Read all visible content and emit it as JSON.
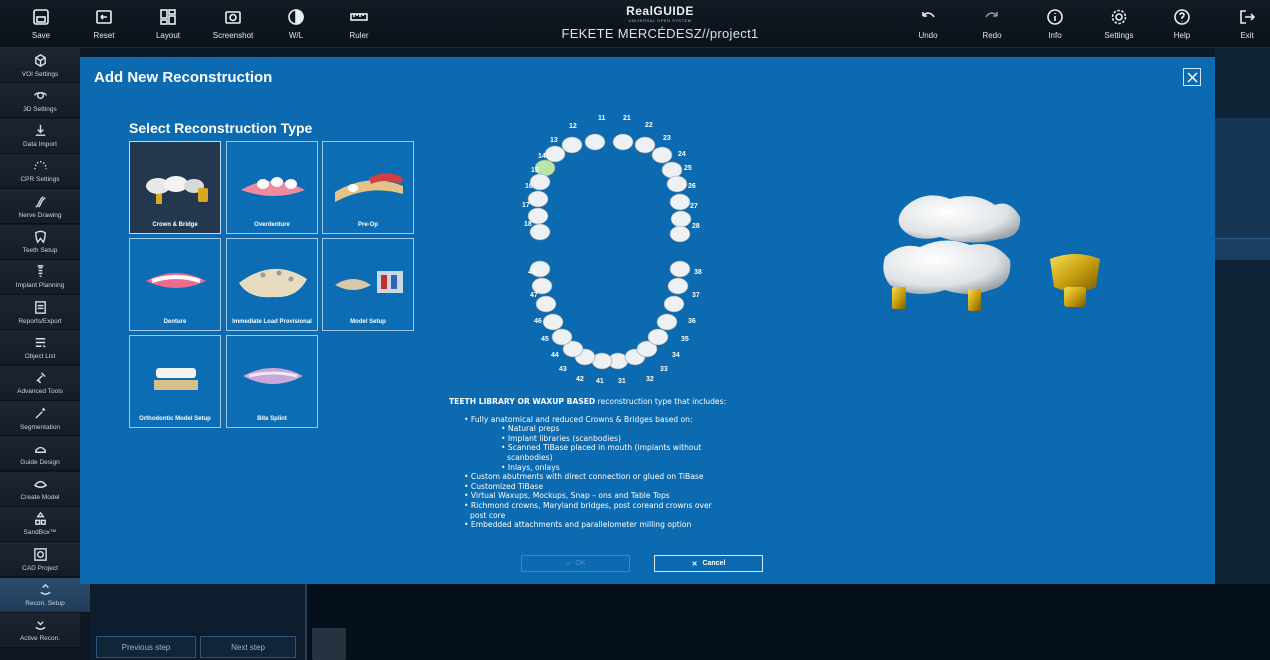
{
  "toolbar": {
    "save": "Save",
    "reset": "Reset",
    "layout": "Layout",
    "screenshot": "Screenshot",
    "wl": "W/L",
    "ruler": "Ruler",
    "undo": "Undo",
    "redo": "Redo",
    "info": "Info",
    "settings": "Settings",
    "help": "Help",
    "exit": "Exit"
  },
  "brand": {
    "logo": "RealGUIDE",
    "sub": "UNIVERSAL OPEN SYSTEM",
    "project": "FEKETE MERCÉDESZ//project1"
  },
  "sidebar": {
    "items": [
      {
        "label": "VOI Settings",
        "icon": "cube-icon"
      },
      {
        "label": "3D Settings",
        "icon": "3d-rotate-icon"
      },
      {
        "label": "Data Import",
        "icon": "import-icon"
      },
      {
        "label": "CPR Settings",
        "icon": "arch-dots-icon"
      },
      {
        "label": "Nerve Drawing",
        "icon": "nerve-icon"
      },
      {
        "label": "Teeth Setup",
        "icon": "tooth-icon"
      },
      {
        "label": "Implant Planning",
        "icon": "implant-icon"
      },
      {
        "label": "Reports/Export",
        "icon": "report-icon"
      },
      {
        "label": "Object List",
        "icon": "list-icon"
      },
      {
        "label": "Advanced Tools",
        "icon": "tools-icon"
      },
      {
        "label": "Segmentation",
        "icon": "wand-icon"
      },
      {
        "label": "Guide Design",
        "icon": "guide-icon"
      },
      {
        "label": "Create Model",
        "icon": "model-icon"
      },
      {
        "label": "SandBox™",
        "icon": "sandbox-icon"
      },
      {
        "label": "CAD Project",
        "icon": "cad-icon"
      },
      {
        "label": "Recon. Setup",
        "icon": "recon-setup-icon"
      },
      {
        "label": "Active Recon.",
        "icon": "active-recon-icon"
      }
    ]
  },
  "steps": {
    "previous": "Previous step",
    "next": "Next step"
  },
  "dialog": {
    "title": "Add New Reconstruction",
    "section_title": "Select Reconstruction Type",
    "tiles": [
      {
        "label": "Crown & Bridge",
        "selected": true
      },
      {
        "label": "Overdenture",
        "selected": false
      },
      {
        "label": "Pre-Op",
        "selected": false
      },
      {
        "label": "Denture",
        "selected": false
      },
      {
        "label": "Immediate Load Provisional",
        "selected": false
      },
      {
        "label": "Model Setup",
        "selected": false
      },
      {
        "label": "Orthodontic Model Setup",
        "selected": false
      },
      {
        "label": "Bite Splint",
        "selected": false
      }
    ],
    "teeth": {
      "upper": [
        "11",
        "12",
        "13",
        "14",
        "15",
        "16",
        "17",
        "18",
        "21",
        "22",
        "23",
        "24",
        "25",
        "26",
        "27",
        "28"
      ],
      "lower": [
        "31",
        "32",
        "33",
        "34",
        "35",
        "36",
        "37",
        "38",
        "41",
        "42",
        "43",
        "44",
        "45",
        "46",
        "47",
        "48"
      ],
      "highlighted": "14"
    },
    "description": {
      "heading_bold": "TEETH LIBRARY OR WAXUP BASED",
      "heading_rest": " reconstruction type that includes:",
      "items": [
        {
          "level": 1,
          "text": "• Fully anatomical and reduced Crowns & Bridges based on:"
        },
        {
          "level": 2,
          "text": "• Natural preps"
        },
        {
          "level": 2,
          "text": "• Implant libraries (scanbodies)"
        },
        {
          "level": 2,
          "text": "• Scanned TiBase placed in mouth (implants without"
        },
        {
          "level": 3,
          "text": "scanbodies)"
        },
        {
          "level": 2,
          "text": "• Inlays, onlays"
        },
        {
          "level": 1,
          "text": "• Custom abutments with direct connection or glued on TiBase"
        },
        {
          "level": 1,
          "text": "• Customized TiBase"
        },
        {
          "level": 1,
          "text": "• Virtual Waxups, Mockups, Snap – ons and Table Tops"
        },
        {
          "level": 1,
          "text": "• Richmond crowns, Maryland bridges, post coreand crowns over"
        },
        {
          "level": 4,
          "text": "post core"
        },
        {
          "level": 1,
          "text": "• Embedded attachments and parallelometer milling option"
        }
      ]
    },
    "ok_label": "OK",
    "cancel_label": "Cancel"
  },
  "colors": {
    "dialog_bg": "#0b6ab0",
    "selected_tile": "#23384d",
    "highlight_tooth": "#b8e6a8"
  }
}
